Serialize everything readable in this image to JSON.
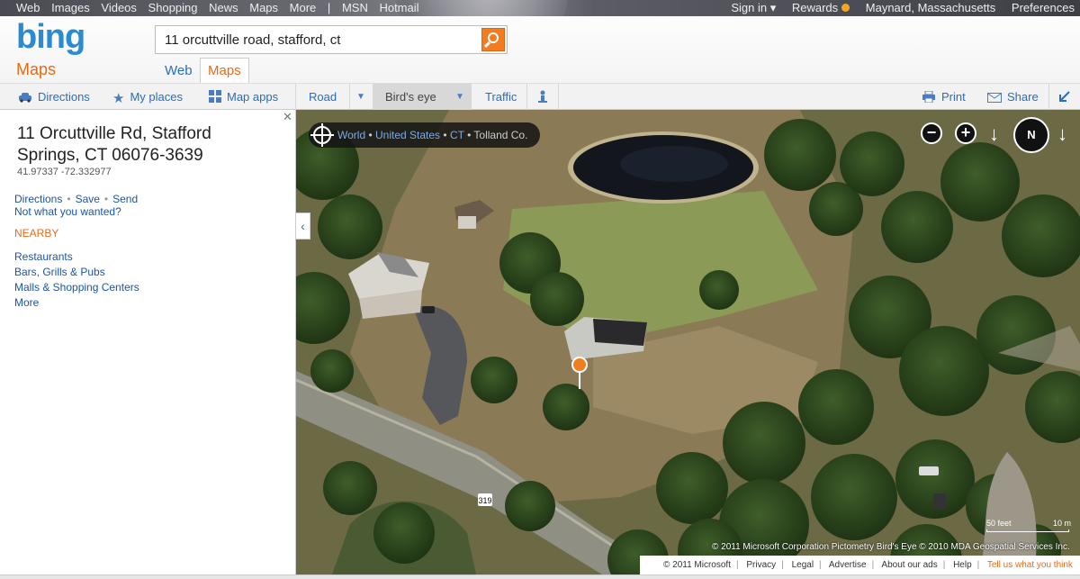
{
  "topbar": {
    "links": [
      "Web",
      "Images",
      "Videos",
      "Shopping",
      "News",
      "Maps",
      "More",
      "|",
      "MSN",
      "Hotmail"
    ],
    "sign_in": "Sign in ▾",
    "rewards": "Rewards",
    "location": "Maynard, Massachusetts",
    "preferences": "Preferences"
  },
  "header": {
    "logo": "bing",
    "logo_sub": "Maps",
    "search_value": "11 orcuttville road, stafford, ct",
    "tab_web": "Web",
    "tab_maps": "Maps"
  },
  "toolbar": {
    "directions": "Directions",
    "my_places": "My places",
    "map_apps": "Map apps",
    "road": "Road",
    "birds_eye": "Bird's eye",
    "traffic": "Traffic",
    "print": "Print",
    "share": "Share"
  },
  "sidebar": {
    "address": "11 Orcuttville Rd, Stafford Springs, CT 06076-3639",
    "coords": "41.97337 -72.332977",
    "directions": "Directions",
    "save": "Save",
    "send": "Send",
    "not_wanted": "Not what you wanted?",
    "nearby_title": "NEARBY",
    "nearby": [
      "Restaurants",
      "Bars, Grills & Pubs",
      "Malls & Shopping Centers",
      "More"
    ]
  },
  "map": {
    "breadcrumb": [
      "World",
      "United States",
      "CT",
      "Tolland Co."
    ],
    "road_shield": "319",
    "scale_feet": "50 feet",
    "scale_m": "10 m",
    "copyright": "© 2011 Microsoft Corporation   Pictometry Bird's Eye © 2010 MDA Geospatial Services Inc."
  },
  "footer": {
    "copyright": "© 2011 Microsoft",
    "privacy": "Privacy",
    "legal": "Legal",
    "advertise": "Advertise",
    "about_ads": "About our ads",
    "help": "Help",
    "tell": "Tell us what you think"
  },
  "colors": {
    "brand_blue": "#2a8bd0",
    "accent_orange": "#e86b16",
    "link_blue": "#1a55a8"
  }
}
